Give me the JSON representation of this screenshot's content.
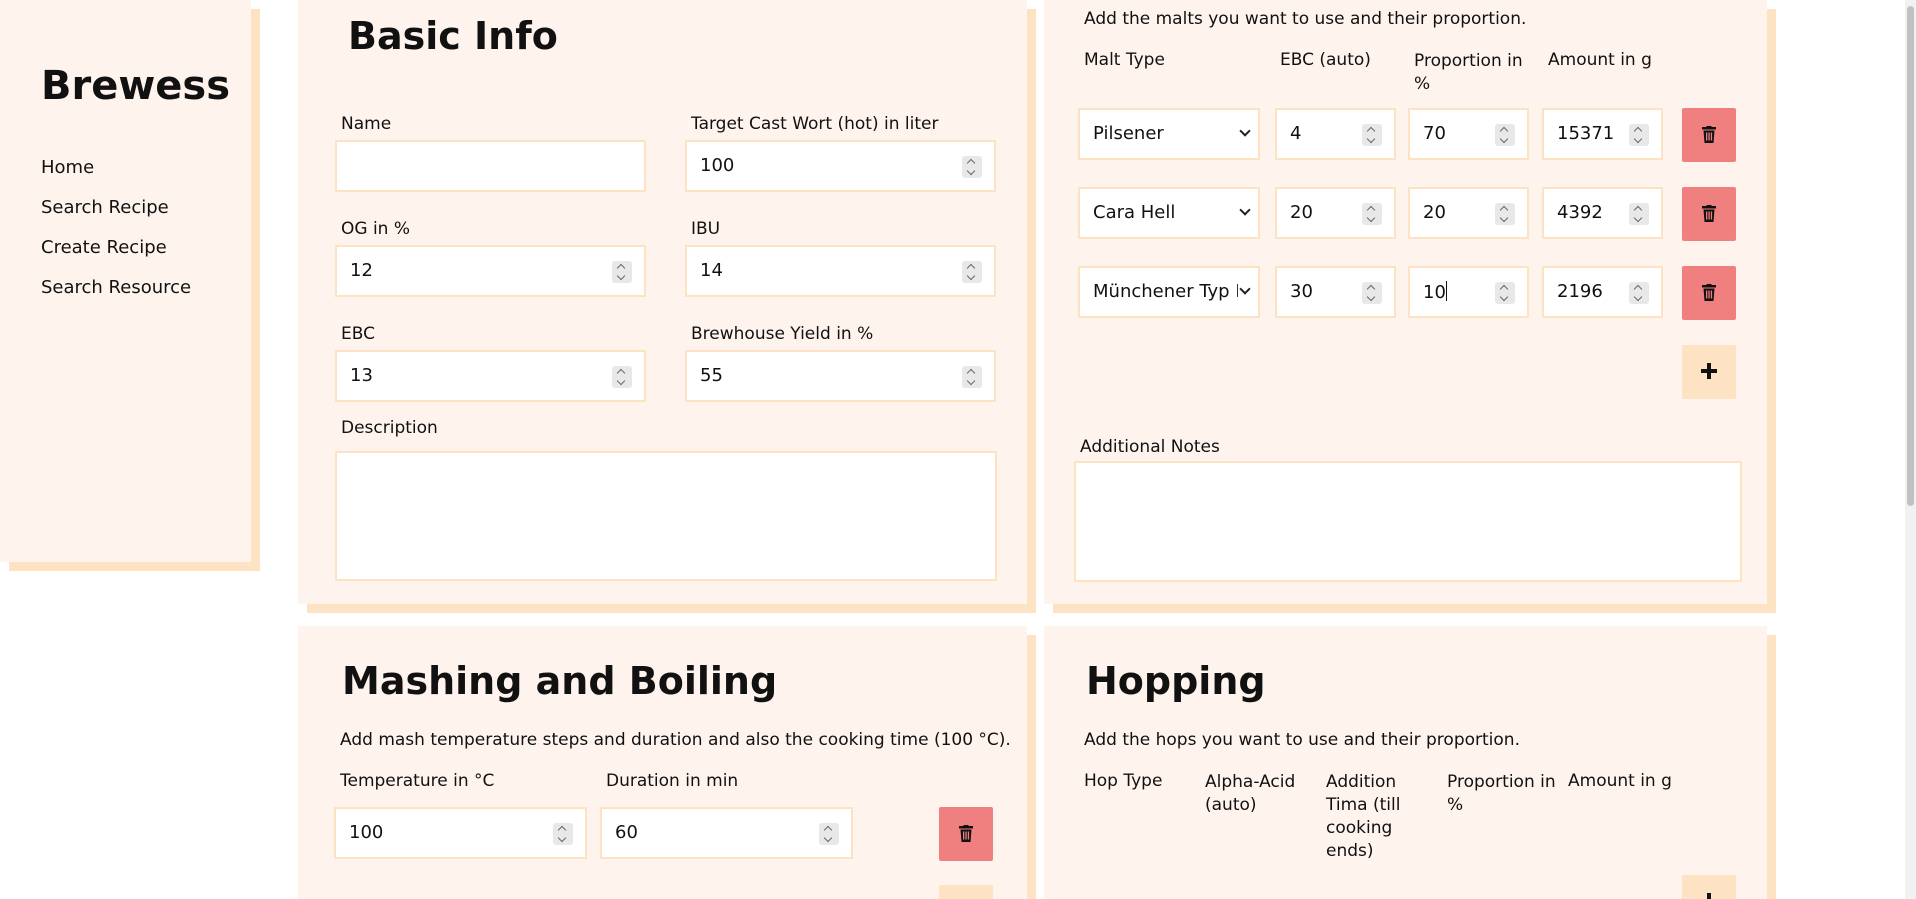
{
  "sidebar": {
    "brand": "Brewess",
    "nav": [
      "Home",
      "Search Recipe",
      "Create Recipe",
      "Search Resource"
    ]
  },
  "basic_info": {
    "title": "Basic Info",
    "name_label": "Name",
    "name_value": "",
    "wort_label": "Target Cast Wort (hot) in liter",
    "wort_value": "100",
    "og_label": "OG in %",
    "og_value": "12",
    "ibu_label": "IBU",
    "ibu_value": "14",
    "ebc_label": "EBC",
    "ebc_value": "13",
    "yield_label": "Brewhouse Yield in %",
    "yield_value": "55",
    "description_label": "Description",
    "description_value": ""
  },
  "malts": {
    "intro": "Add the malts you want to use and their proportion.",
    "headers": [
      "Malt Type",
      "EBC (auto)",
      "Proportion in %",
      "Amount in g"
    ],
    "rows": [
      {
        "type": "Pilsener",
        "ebc": "4",
        "proportion": "70",
        "amount": "15371"
      },
      {
        "type": "Cara Hell",
        "ebc": "20",
        "proportion": "20",
        "amount": "4392"
      },
      {
        "type": "Münchener Typ II",
        "ebc": "30",
        "proportion": "10",
        "amount": "2196"
      }
    ],
    "notes_label": "Additional Notes",
    "notes_value": ""
  },
  "mashing": {
    "title": "Mashing and Boiling",
    "intro": "Add mash temperature steps and duration and also the cooking time (100 °C).",
    "temp_label": "Temperature in °C",
    "duration_label": "Duration in min",
    "temp_value": "100",
    "duration_value": "60"
  },
  "hopping": {
    "title": "Hopping",
    "intro": "Add the hops you want to use and their proportion.",
    "headers": [
      "Hop Type",
      "Alpha-Acid (auto)",
      "Addition Tima (till cooking ends)",
      "Proportion in %",
      "Amount in g"
    ]
  }
}
